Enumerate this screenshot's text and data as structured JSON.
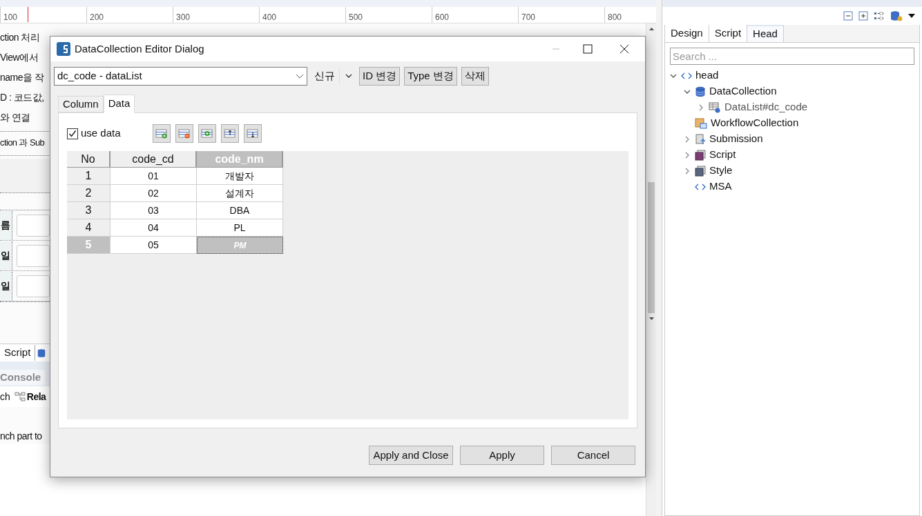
{
  "editor": {
    "ruler": [
      "100",
      "200",
      "300",
      "400",
      "500",
      "600",
      "700",
      "800"
    ],
    "text_lines": [
      "ction 처리",
      "View에서",
      "name을 작",
      "D : 코드값,",
      "와 연결"
    ],
    "section_title": "ction 과 Sub",
    "field_labels": [
      "름",
      "일",
      "일"
    ],
    "tab": "Script"
  },
  "console": {
    "tab": "Console",
    "toolbar_texts": [
      "ch",
      "Rela"
    ],
    "message": "nch part to"
  },
  "outline": {
    "tabs": [
      {
        "label": "Design",
        "selected": false
      },
      {
        "label": "Script",
        "selected": false
      },
      {
        "label": "Head",
        "selected": true
      }
    ],
    "search": {
      "placeholder": "Search ..."
    },
    "tree": [
      {
        "label": "head",
        "kind": "tag",
        "expanded": true,
        "children": [
          {
            "label": "DataCollection",
            "kind": "datacollection",
            "expanded": true,
            "children": [
              {
                "label": "DataList#dc_code",
                "kind": "datalist",
                "expanded": false
              }
            ]
          },
          {
            "label": "WorkflowCollection",
            "kind": "workflow"
          },
          {
            "label": "Submission",
            "kind": "submission",
            "expanded": false
          },
          {
            "label": "Script",
            "kind": "script",
            "expanded": false
          },
          {
            "label": "Style",
            "kind": "style",
            "expanded": false
          },
          {
            "label": "MSA",
            "kind": "tag"
          }
        ]
      }
    ]
  },
  "dialog": {
    "title": "DataCollection Editor Dialog",
    "selector": {
      "value": "dc_code - dataList"
    },
    "new_menu": "신규",
    "buttons": [
      "ID 변경",
      "Type 변경",
      "삭제"
    ],
    "tabs": [
      {
        "label": "Column",
        "selected": false
      },
      {
        "label": "Data",
        "selected": true
      }
    ],
    "use_data": {
      "label": "use data",
      "checked": true
    },
    "grid": {
      "columns": [
        {
          "label": "No",
          "selected": false
        },
        {
          "label": "code_cd",
          "selected": false
        },
        {
          "label": "code_nm",
          "selected": true
        }
      ],
      "rows": [
        {
          "cells": [
            "1",
            "01",
            "개발자"
          ],
          "selected": false
        },
        {
          "cells": [
            "2",
            "02",
            "설계자"
          ],
          "selected": false
        },
        {
          "cells": [
            "3",
            "03",
            "DBA"
          ],
          "selected": false
        },
        {
          "cells": [
            "4",
            "04",
            "PL"
          ],
          "selected": false
        },
        {
          "cells": [
            "5",
            "05",
            "PM"
          ],
          "selected": true
        }
      ]
    },
    "footer_buttons": [
      "Apply and Close",
      "Apply",
      "Cancel"
    ]
  }
}
